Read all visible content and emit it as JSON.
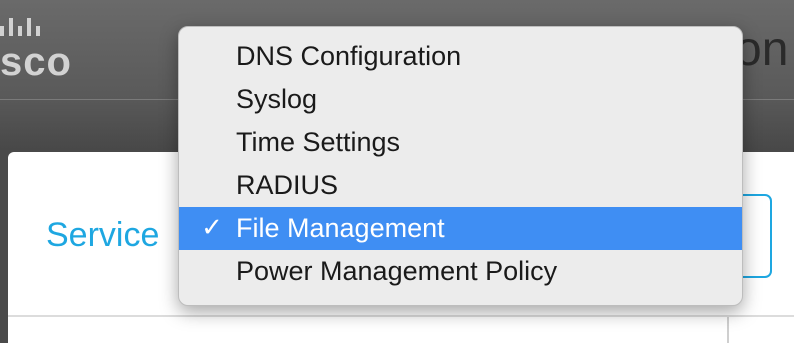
{
  "header": {
    "logo_text": "sco",
    "right_text": "on"
  },
  "panel": {
    "title": "Service"
  },
  "dropdown": {
    "items": [
      {
        "label": "DNS Configuration",
        "selected": false
      },
      {
        "label": "Syslog",
        "selected": false
      },
      {
        "label": "Time Settings",
        "selected": false
      },
      {
        "label": "RADIUS",
        "selected": false
      },
      {
        "label": "File Management",
        "selected": true,
        "check": "✓"
      },
      {
        "label": "Power Management Policy",
        "selected": false
      }
    ]
  },
  "colors": {
    "accent": "#1ea7e1",
    "selection": "#3f8ef3",
    "header": "#5a5a5a"
  },
  "icons": {
    "logo": "cisco-bars-logo",
    "selected_item": "checkmark-icon"
  }
}
